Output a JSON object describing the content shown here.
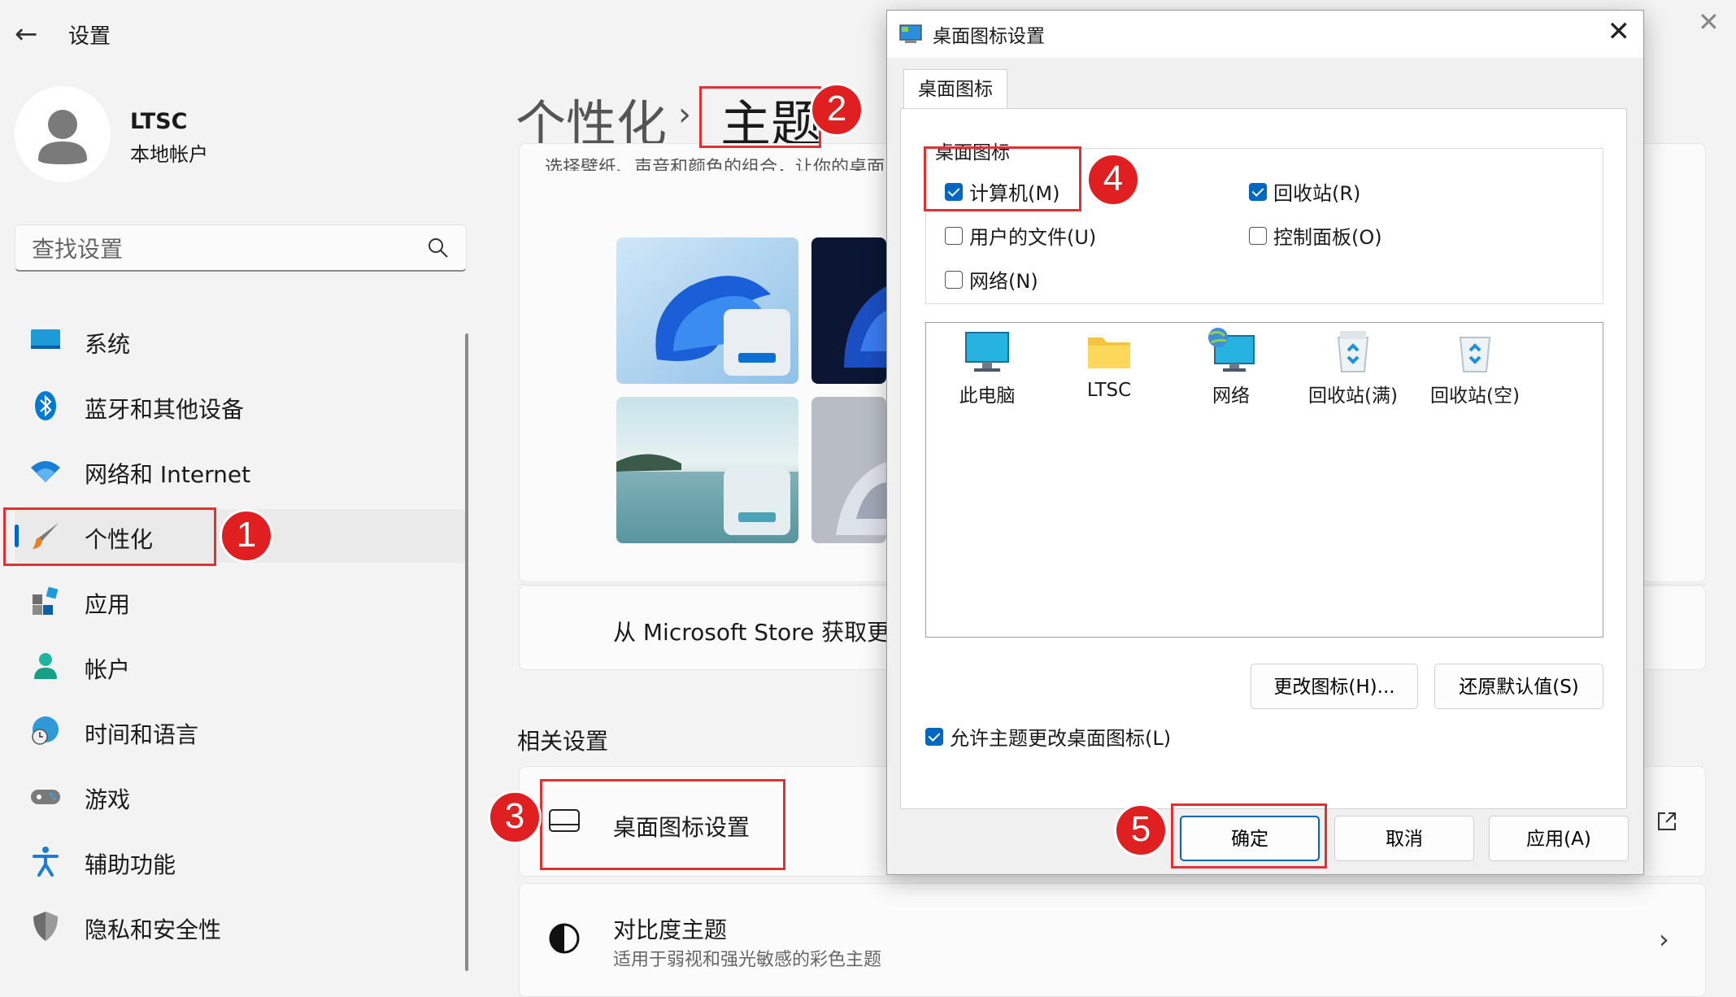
{
  "app": {
    "title": "设置"
  },
  "user": {
    "name": "LTSC",
    "type": "本地帐户"
  },
  "search": {
    "placeholder": "查找设置"
  },
  "nav": [
    {
      "label": "系统",
      "icon": "monitor-icon"
    },
    {
      "label": "蓝牙和其他设备",
      "icon": "bluetooth-icon"
    },
    {
      "label": "网络和 Internet",
      "icon": "wifi-icon"
    },
    {
      "label": "个性化",
      "icon": "paintbrush-icon",
      "active": true
    },
    {
      "label": "应用",
      "icon": "apps-icon"
    },
    {
      "label": "帐户",
      "icon": "person-icon"
    },
    {
      "label": "时间和语言",
      "icon": "globe-clock-icon"
    },
    {
      "label": "游戏",
      "icon": "gamepad-icon"
    },
    {
      "label": "辅助功能",
      "icon": "accessibility-icon"
    },
    {
      "label": "隐私和安全性",
      "icon": "shield-icon"
    }
  ],
  "breadcrumb": {
    "parent": "个性化",
    "separator": "›",
    "current": "主题"
  },
  "themes": {
    "description_cut": "选择壁纸、声音和颜色的组合，让你的桌面",
    "store_text": "从 Microsoft Store 获取更多主题"
  },
  "related": {
    "title": "相关设置",
    "desktop_icons": {
      "title": "桌面图标设置"
    },
    "contrast": {
      "title": "对比度主题",
      "subtitle": "适用于弱视和强光敏感的彩色主题"
    }
  },
  "dialog": {
    "title": "桌面图标设置",
    "tab": "桌面图标",
    "group_label": "桌面图标",
    "checkboxes": [
      {
        "label": "计算机(M)",
        "checked": true
      },
      {
        "label": "回收站(R)",
        "checked": true
      },
      {
        "label": "用户的文件(U)",
        "checked": false
      },
      {
        "label": "控制面板(O)",
        "checked": false
      },
      {
        "label": "网络(N)",
        "checked": false
      }
    ],
    "icons": [
      {
        "label": "此电脑",
        "icon": "this-pc-icon"
      },
      {
        "label": "LTSC",
        "icon": "user-folder-icon"
      },
      {
        "label": "网络",
        "icon": "network-icon"
      },
      {
        "label": "回收站(满)",
        "icon": "recycle-bin-full-icon"
      },
      {
        "label": "回收站(空)",
        "icon": "recycle-bin-empty-icon"
      }
    ],
    "change_icon": "更改图标(H)...",
    "restore_default": "还原默认值(S)",
    "allow_themes": {
      "label": "允许主题更改桌面图标(L)",
      "checked": true
    },
    "ok": "确定",
    "cancel": "取消",
    "apply": "应用(A)"
  },
  "annotations": [
    "1",
    "2",
    "3",
    "4",
    "5"
  ],
  "colors": {
    "accent": "#0067c0",
    "annotation": "#e02020"
  }
}
